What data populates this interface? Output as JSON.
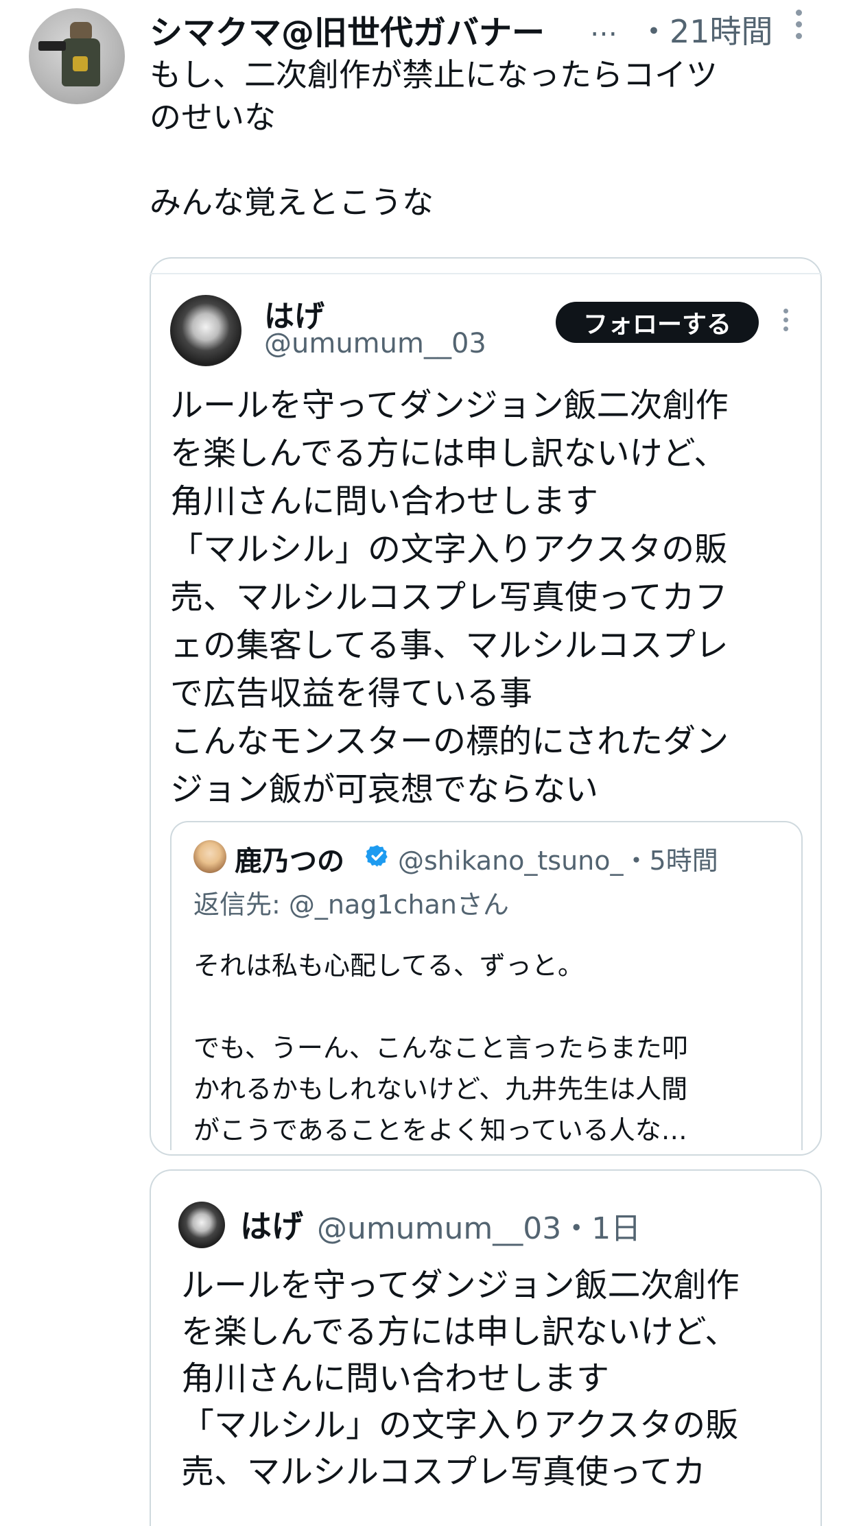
{
  "main_post": {
    "display_name": "シマクマ@旧世代ガバナー",
    "ellipsis": "…",
    "time": "・21時間",
    "text": "もし、二次創作が禁止になったらコイツ\nのせいな\n\nみんな覚えとこうな"
  },
  "embedded_tweet": {
    "display_name": "はげ",
    "handle": "@umumum__03",
    "follow_label": "フォローする",
    "text": "ルールを守ってダンジョン飯二次創作\nを楽しんでる方には申し訳ないけど、\n角川さんに問い合わせします\n「マルシル」の文字入りアクスタの販\n売、マルシルコスプレ写真使ってカフ\nェの集客してる事、マルシルコスプレ\nで広告収益を得ている事\nこんなモンスターの標的にされたダン\nジョン飯が可哀想でならない"
  },
  "nested_quote": {
    "display_name": "鹿乃つの",
    "handle_time": "@shikano_tsuno_・5時間",
    "reply_to": "返信先: @_nag1chanさん",
    "text": "それは私も心配してる、ずっと。\n\nでも、うーん、こんなこと言ったらまた叩\nかれるかもしれないけど、九井先生は人間\nがこうであることをよく知っている人な…"
  },
  "second_tweet": {
    "display_name": "はげ",
    "meta": "@umumum__03・1日",
    "text": "ルールを守ってダンジョン飯二次創作\nを楽しんでる方には申し訳ないけど、\n角川さんに問い合わせします\n「マルシル」の文字入りアクスタの販\n売、マルシルコスプレ写真使ってカ"
  },
  "colors": {
    "text": "#0f1419",
    "secondary": "#536471",
    "border": "#cfd9de",
    "verified": "#1d9bf0",
    "button_bg": "#0f1419"
  }
}
